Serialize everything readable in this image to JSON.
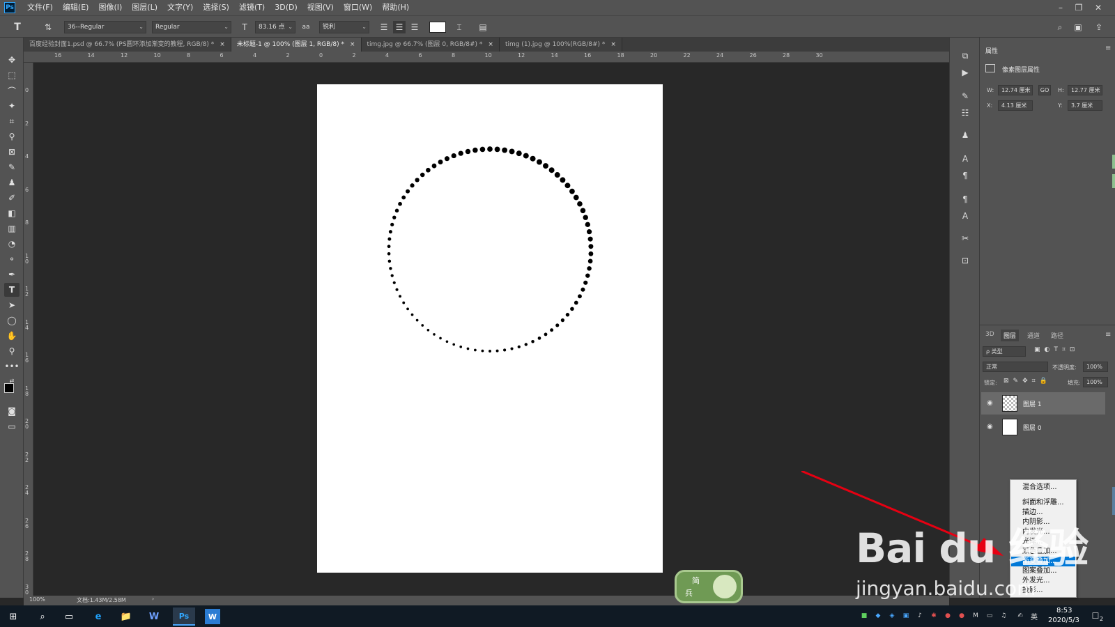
{
  "app": {
    "logo": "Ps"
  },
  "menu": [
    "文件(F)",
    "编辑(E)",
    "图像(I)",
    "图层(L)",
    "文字(Y)",
    "选择(S)",
    "滤镜(T)",
    "3D(D)",
    "视图(V)",
    "窗口(W)",
    "帮助(H)"
  ],
  "window_controls": [
    "–",
    "❐",
    "✕"
  ],
  "options": {
    "tool_glyph": "T",
    "font_family": "36--Regular",
    "font_style": "Regular",
    "font_size": "83.16 点",
    "antialias": "锐利",
    "color": "#ffffff"
  },
  "tabs": [
    {
      "label": "百度经验封面1.psd @ 66.7% (PS圆环添加渐变的教程, RGB/8) *",
      "active": false
    },
    {
      "label": "未标题-1 @ 100% (图层 1, RGB/8) *",
      "active": true
    },
    {
      "label": "timg.jpg @ 66.7% (图层 0, RGB/8#) *",
      "active": false
    },
    {
      "label": "timg (1).jpg @ 100%(RGB/8#) *",
      "active": false
    }
  ],
  "tab_close": "×",
  "ruler_top": [
    "16",
    "14",
    "12",
    "10",
    "8",
    "6",
    "4",
    "2",
    "0",
    "2",
    "4",
    "6",
    "8",
    "10",
    "12",
    "14",
    "16",
    "18",
    "20",
    "22",
    "24",
    "26",
    "28",
    "30"
  ],
  "ruler_left": [
    "0",
    "2",
    "4",
    "6",
    "8",
    "1 0",
    "1 2",
    "1 4",
    "1 6",
    "1 8",
    "2 0",
    "2 2",
    "2 4",
    "2 6",
    "2 8",
    "3 0"
  ],
  "status": {
    "zoom": "100%",
    "doc": "文档:1.43M/2.58M",
    "arrow": "›"
  },
  "properties": {
    "tab": "属性",
    "title": "像素图层属性",
    "w_label": "W:",
    "w": "12.74 厘米",
    "h_label": "H:",
    "h": "12.77 厘米",
    "x_label": "X:",
    "x": "4.13 厘米",
    "y_label": "Y:",
    "y": "3.7 厘米",
    "link": "GO"
  },
  "layers_panel": {
    "tabs": [
      {
        "label": "3D",
        "active": false
      },
      {
        "label": "图层",
        "active": true
      },
      {
        "label": "通道",
        "active": false
      },
      {
        "label": "路径",
        "active": false
      }
    ],
    "filter": "ρ 类型",
    "blend_mode": "正常",
    "opacity_label": "不透明度:",
    "opacity": "100%",
    "lock_label": "锁定:",
    "fill_label": "填充:",
    "fill": "100%",
    "layers": [
      {
        "name": "图层 1",
        "selected": true,
        "transparent": true
      },
      {
        "name": "图层 0",
        "selected": false,
        "transparent": false
      }
    ]
  },
  "context_menu": [
    {
      "label": "混合选项...",
      "highlight": false
    },
    {
      "label": "斜面和浮雕...",
      "highlight": false
    },
    {
      "label": "描边...",
      "highlight": false
    },
    {
      "label": "内阴影...",
      "highlight": false
    },
    {
      "label": "内发光...",
      "highlight": false
    },
    {
      "label": "光泽...",
      "highlight": false
    },
    {
      "label": "颜色叠加...",
      "highlight": false
    },
    {
      "label": "渐变叠加...",
      "highlight": true
    },
    {
      "label": "图案叠加...",
      "highlight": false
    },
    {
      "label": "外发光...",
      "highlight": false
    },
    {
      "label": "投影...",
      "highlight": false
    }
  ],
  "watermark": {
    "brand": "Bai du 经验",
    "url": "jingyan.baidu.com",
    "badge_top": "简",
    "badge_bottom": "兵"
  },
  "taskbar": {
    "time": "8:53",
    "date": "2020/5/3",
    "ime": "英",
    "notif": "2",
    "apps": [
      "⊞",
      "⌕",
      "▭",
      "e",
      "📁",
      "W",
      "Ps",
      "W"
    ]
  }
}
